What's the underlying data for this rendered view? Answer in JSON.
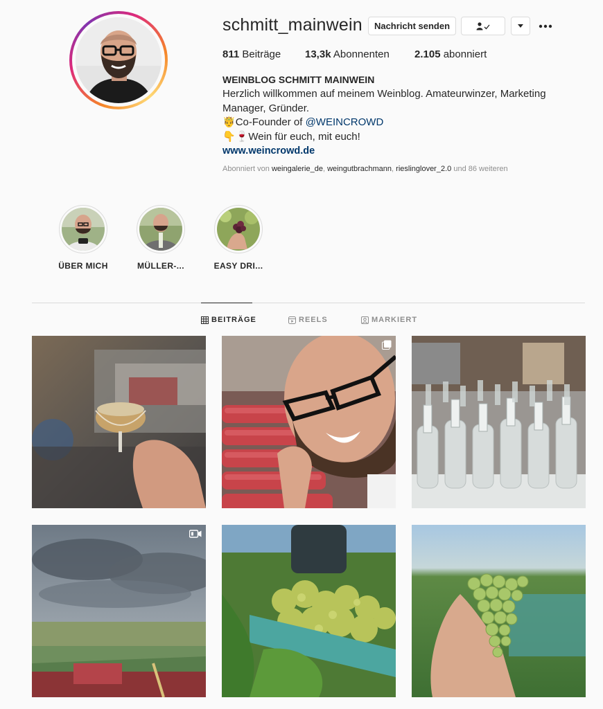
{
  "profile": {
    "username": "schmitt_mainwein",
    "message_button": "Nachricht senden",
    "follow_icon": "person-check-icon",
    "stats": {
      "posts_count": "811",
      "posts_label": "Beiträge",
      "followers_count": "13,3k",
      "followers_label": "Abonnenten",
      "following_count": "2.105",
      "following_label": "abonniert"
    },
    "bio": {
      "name": "WEINBLOG SCHMITT MAINWEIN",
      "line1": "Herzlich willkommen auf meinem Weinblog. Amateurwinzer, Marketing Manager, Gründer.",
      "line2_emoji": "🤴",
      "line2_prefix": "Co-Founder of ",
      "line2_mention": "@WEINCROWD",
      "line3_emoji": "👇🍷",
      "line3_text": "Wein für euch, mit euch!",
      "website": "www.weincrowd.de"
    },
    "followed_by": {
      "prefix": "Abonniert von",
      "user1": "weingalerie_de",
      "user2": "weingutbrachmann",
      "user3": "rieslinglover_2.0",
      "suffix": "und 86 weiteren"
    }
  },
  "highlights": [
    {
      "label": "ÜBER MICH"
    },
    {
      "label": "MÜLLER-..."
    },
    {
      "label": "EASY DRI..."
    }
  ],
  "tabs": [
    {
      "label": "BEITRÄGE",
      "icon": "grid-icon",
      "active": true
    },
    {
      "label": "REELS",
      "icon": "reels-icon",
      "active": false
    },
    {
      "label": "MARKIERT",
      "icon": "tagged-icon",
      "active": false
    }
  ],
  "colors": {
    "text": "#262626",
    "muted": "#8e8e8e",
    "link": "#00376b",
    "border": "#dbdbdb",
    "background": "#fafafa"
  }
}
